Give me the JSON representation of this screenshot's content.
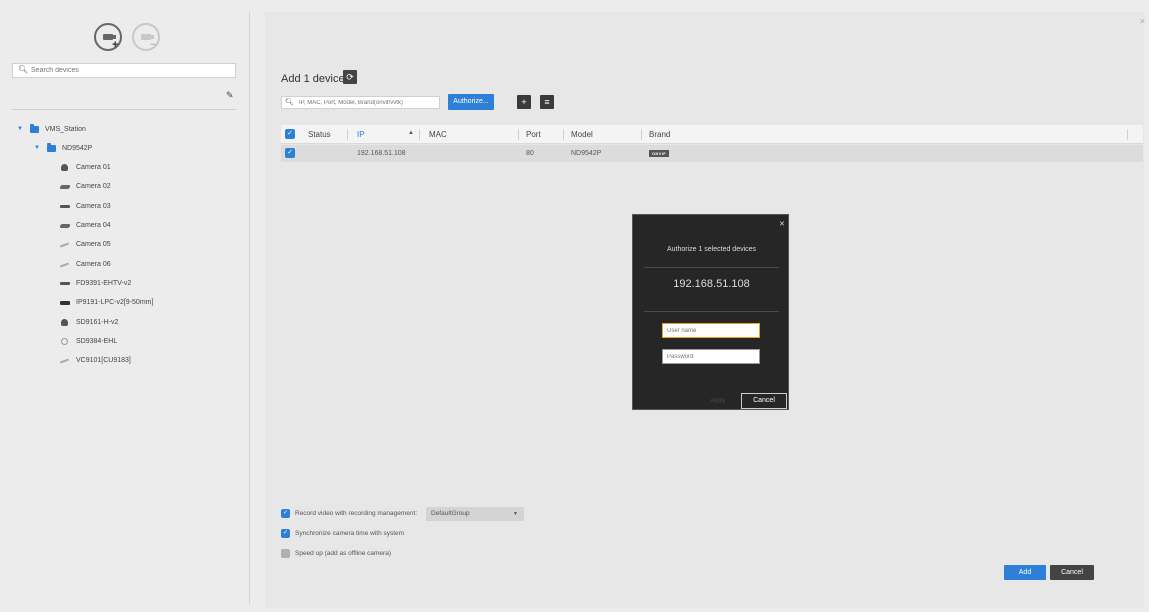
{
  "left_panel": {
    "add_camera_button": "+",
    "remove_camera_button": "−",
    "search_placeholder": "Search devices",
    "tree": [
      {
        "label": "VMS_Station",
        "type": "folder",
        "level": 0,
        "icon": "folder-icon"
      },
      {
        "label": "ND9542P",
        "type": "folder",
        "level": 1,
        "icon": "folder-icon"
      },
      {
        "label": "Camera 01",
        "type": "camera",
        "level": 2,
        "icon": "dome-camera-icon"
      },
      {
        "label": "Camera 02",
        "type": "camera",
        "level": 2,
        "icon": "bullet-camera-icon"
      },
      {
        "label": "Camera 03",
        "type": "camera",
        "level": 2,
        "icon": "flat-camera-icon"
      },
      {
        "label": "Camera 04",
        "type": "camera",
        "level": 2,
        "icon": "bullet-camera-icon"
      },
      {
        "label": "Camera 05",
        "type": "camera",
        "level": 2,
        "icon": "disabled-camera-icon"
      },
      {
        "label": "Camera 06",
        "type": "camera",
        "level": 2,
        "icon": "disabled-camera-icon"
      },
      {
        "label": "FD9391-EHTV-v2",
        "type": "device",
        "level": 1,
        "icon": "flat-camera-icon"
      },
      {
        "label": "IP9191-LPC-v2[9-50mm]",
        "type": "device",
        "level": 1,
        "icon": "box-camera-icon"
      },
      {
        "label": "SD9161-H-v2",
        "type": "device",
        "level": 1,
        "icon": "dome-camera-icon"
      },
      {
        "label": "SD9384-EHL",
        "type": "device",
        "level": 1,
        "icon": "fisheye-camera-icon"
      },
      {
        "label": "VC9101[CU9183]",
        "type": "device",
        "level": 1,
        "icon": "disabled-camera-icon"
      }
    ]
  },
  "main": {
    "title": "Add 1 devices",
    "filter_placeholder": "IP, MAC, Port, Model, Brand(onvif/vvtk)",
    "authorize_label": "Authorize...",
    "add_button_icon": "+",
    "list_button_icon": "≡",
    "table": {
      "columns": [
        "Status",
        "IP",
        "MAC",
        "Port",
        "Model",
        "Brand"
      ],
      "rows": [
        {
          "status": "",
          "ip": "192.168.51.108",
          "mac": "",
          "port": "80",
          "model": "ND9542P",
          "brand": "ONVIF",
          "checked": true
        }
      ]
    },
    "options": {
      "record_label": "Record video with recording management:",
      "record_checked": true,
      "record_group": "DefaultGroup",
      "sync_label": "Synchronize camera time with system",
      "sync_checked": true,
      "speed_label": "Speed up (add as offline camera)",
      "speed_checked": false
    },
    "add_label": "Add",
    "cancel_label": "Cancel"
  },
  "modal": {
    "title": "Authorize 1 selected devices",
    "ip": "192.168.51.108",
    "username_placeholder": "User name",
    "password_placeholder": "Password",
    "apply_label": "Apply",
    "cancel_label": "Cancel"
  },
  "colors": {
    "accent": "#2d7fd8",
    "modal_bg": "#262626",
    "focus": "#f0a020"
  }
}
